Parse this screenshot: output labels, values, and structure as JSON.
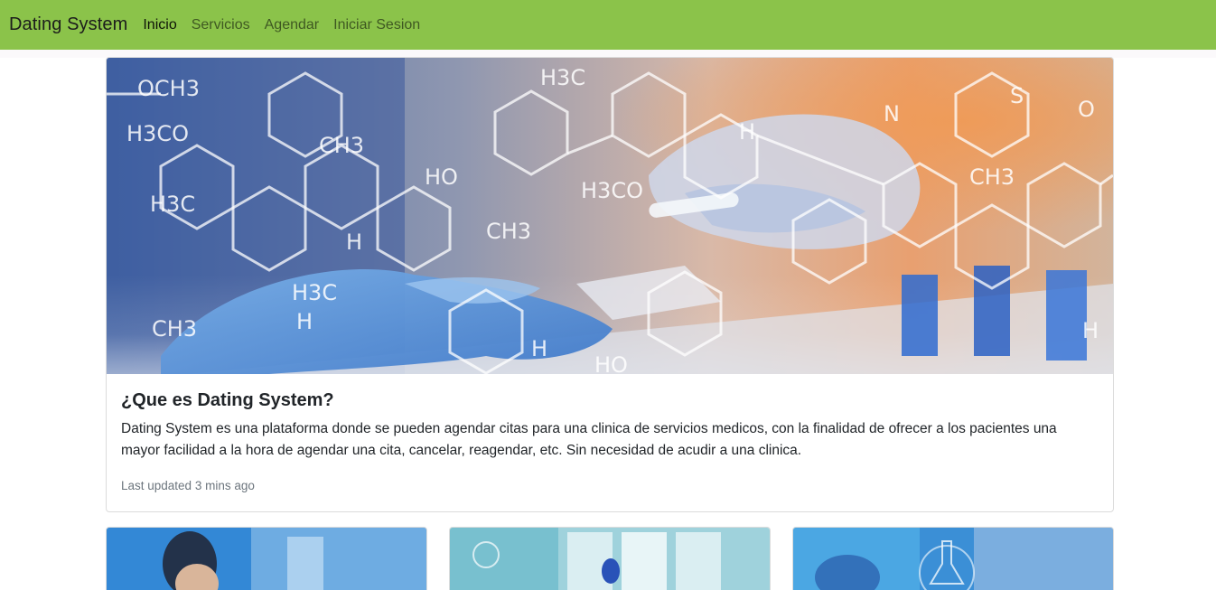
{
  "navbar": {
    "brand": "Dating System",
    "links": [
      {
        "label": "Inicio",
        "active": true
      },
      {
        "label": "Servicios",
        "active": false
      },
      {
        "label": "Agendar",
        "active": false
      },
      {
        "label": "Iniciar Sesion",
        "active": false
      }
    ],
    "background_color": "#8bc34a"
  },
  "hero_card": {
    "title": "¿Que es Dating System?",
    "text": "Dating System es una plataforma donde se pueden agendar citas para una clinica de servicios medicos, con la finalidad de ofrecer a los pacientes una mayor facilidad a la hora de agendar una cita, cancelar, reagendar, etc. Sin necesidad de acudir a una clinica.",
    "updated": "Last updated 3 mins ago",
    "image": {
      "formulas": [
        "OCH3",
        "H3CO",
        "CH3",
        "HO",
        "H3C",
        "H3CO",
        "CH3",
        "H3C",
        "H",
        "H",
        "H",
        "HO",
        "CH3",
        "H3C",
        "H",
        "CH3",
        "H",
        "N",
        "S",
        "O"
      ]
    }
  }
}
